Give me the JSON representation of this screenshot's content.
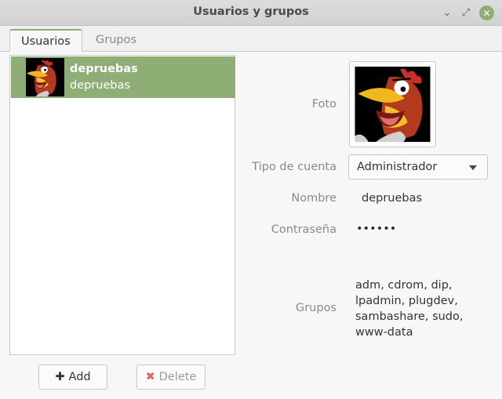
{
  "window": {
    "title": "Usuarios y grupos",
    "buttons": {
      "minimize": "⌄",
      "maximize": "⤢",
      "close": "✕"
    },
    "accent_color": "#8fae75"
  },
  "tabs": [
    {
      "label": "Usuarios",
      "active": true
    },
    {
      "label": "Grupos",
      "active": false
    }
  ],
  "users": [
    {
      "name": "depruebas",
      "login": "depruebas",
      "avatar": "rooster-avatar",
      "selected": true
    }
  ],
  "actions": {
    "add_label": "Add",
    "add_icon": "✚",
    "delete_label": "Delete",
    "delete_icon": "✖"
  },
  "details": {
    "photo_label": "Foto",
    "account_type_label": "Tipo de cuenta",
    "account_type_value": "Administrador",
    "name_label": "Nombre",
    "name_value": "depruebas",
    "password_label": "Contraseña",
    "password_value": "••••••",
    "groups_label": "Grupos",
    "groups_value": "adm, cdrom, dip, lpadmin, plugdev, sambashare, sudo, www-data"
  }
}
